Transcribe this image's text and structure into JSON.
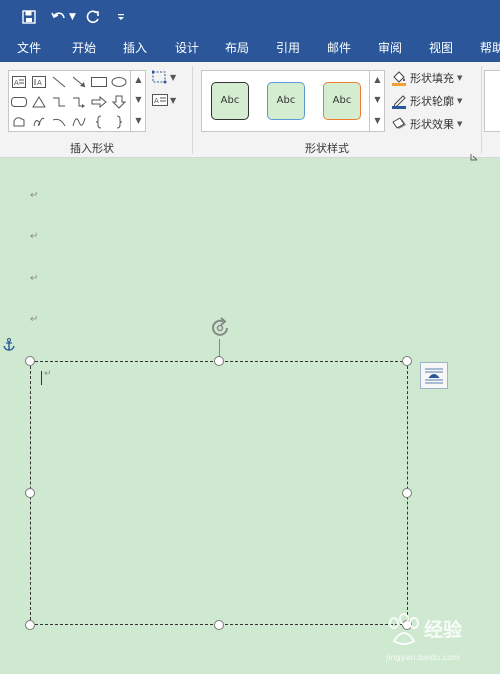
{
  "quick_access": {
    "save_icon": "save-icon",
    "undo_icon": "undo-icon",
    "redo_icon": "redo-icon",
    "customize_icon": "customize-quick-access-icon"
  },
  "menu": {
    "items": [
      "文件",
      "开始",
      "插入",
      "设计",
      "布局",
      "引用",
      "邮件",
      "审阅",
      "视图",
      "帮助"
    ]
  },
  "ribbon": {
    "insert_shapes_label": "插入形状",
    "shape_styles_label": "形状样式",
    "style_samples": [
      "Abc",
      "Abc",
      "Abc"
    ],
    "shape_fill_label": "形状填充",
    "shape_outline_label": "形状轮廓",
    "shape_effects_label": "形状效果"
  },
  "document": {
    "paragraph_mark": "↵",
    "textbox_paragraph_mark": "↵"
  },
  "watermark": {
    "brand_text": "经验",
    "url_text": "jingyan.baidu.com"
  },
  "colors": {
    "title_bar": "#2b579a",
    "ribbon_bg": "#f3f3f3",
    "page_bg": "#cfe9d1",
    "style_swatch_fill": "#d4ecd0",
    "style_border_1": "#333333",
    "style_border_2": "#5b9bd5",
    "style_border_3": "#ed7d31",
    "fill_bar": "#f0a030",
    "outline_bar": "#2b579a"
  }
}
